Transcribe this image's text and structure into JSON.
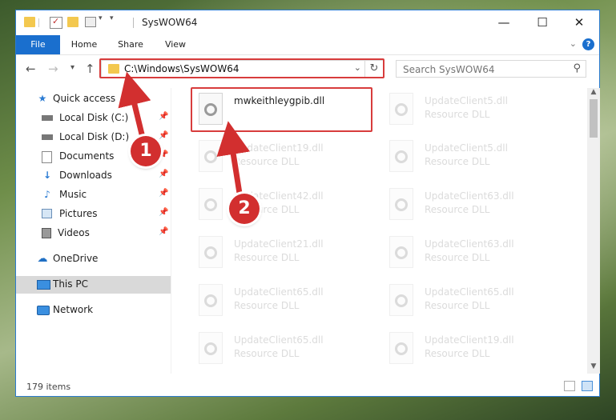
{
  "titlebar": {
    "title": "SysWOW64",
    "minimize": "—",
    "maximize": "☐",
    "close": "✕"
  },
  "ribbon": {
    "tabs": [
      "File",
      "Home",
      "Share",
      "View"
    ],
    "help": "?"
  },
  "address": {
    "path": "C:\\Windows\\SysWOW64"
  },
  "search": {
    "placeholder": "Search SysWOW64"
  },
  "sidebar": {
    "items": [
      {
        "label": "Quick access",
        "icon": "star-icon",
        "pinned": false
      },
      {
        "label": "Local Disk (C:)",
        "icon": "drive-icon",
        "pinned": true
      },
      {
        "label": "Local Disk (D:)",
        "icon": "drive-icon",
        "pinned": true
      },
      {
        "label": "Documents",
        "icon": "documents-icon",
        "pinned": true
      },
      {
        "label": "Downloads",
        "icon": "download-icon",
        "pinned": true
      },
      {
        "label": "Music",
        "icon": "music-icon",
        "pinned": true
      },
      {
        "label": "Pictures",
        "icon": "pictures-icon",
        "pinned": true
      },
      {
        "label": "Videos",
        "icon": "videos-icon",
        "pinned": true
      },
      {
        "label": "OneDrive",
        "icon": "cloud-icon",
        "pinned": false
      },
      {
        "label": "This PC",
        "icon": "computer-icon",
        "pinned": false,
        "selected": true
      },
      {
        "label": "Network",
        "icon": "network-icon",
        "pinned": false
      }
    ]
  },
  "files": [
    {
      "name": "mwkeithleygpib.dll",
      "type": "",
      "highlighted": true
    },
    {
      "name": "UpdateClient5.dll",
      "type": "Resource DLL"
    },
    {
      "name": "UpdateClient19.dll",
      "type": "Resource DLL"
    },
    {
      "name": "UpdateClient5.dll",
      "type": "Resource DLL"
    },
    {
      "name": "UpdateClient42.dll",
      "type": "Resource DLL"
    },
    {
      "name": "UpdateClient63.dll",
      "type": "Resource DLL"
    },
    {
      "name": "UpdateClient21.dll",
      "type": "Resource DLL"
    },
    {
      "name": "UpdateClient63.dll",
      "type": "Resource DLL"
    },
    {
      "name": "UpdateClient65.dll",
      "type": "Resource DLL"
    },
    {
      "name": "UpdateClient65.dll",
      "type": "Resource DLL"
    },
    {
      "name": "UpdateClient65.dll",
      "type": "Resource DLL"
    },
    {
      "name": "UpdateClient19.dll",
      "type": "Resource DLL"
    },
    {
      "name": "",
      "type": ""
    },
    {
      "name": "",
      "type": ""
    }
  ],
  "status": {
    "count": "179 items"
  },
  "annotations": {
    "badge1": "1",
    "badge2": "2",
    "color": "#d22f2f"
  }
}
